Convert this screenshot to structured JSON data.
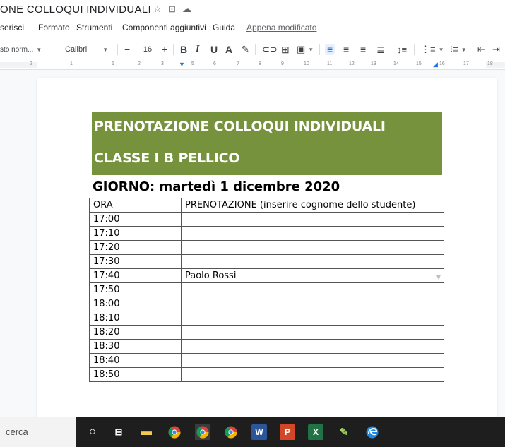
{
  "doc": {
    "title": "ONE COLLOQUI INDIVIDUALI"
  },
  "title_icons": [
    "star-icon",
    "move-to-folder-icon",
    "cloud-status-icon"
  ],
  "menu": {
    "items": [
      "serisci",
      "Formato",
      "Strumenti",
      "Componenti aggiuntivi",
      "Guida"
    ],
    "last_edit": "Appena modificato"
  },
  "toolbar": {
    "style_label": "sto norm...",
    "font_label": "Calibri",
    "font_size_minus": "−",
    "font_size": "16",
    "font_size_plus": "+",
    "bold": "B",
    "italic": "I",
    "underline": "U",
    "text_color": "A"
  },
  "ruler": {
    "ticks": [
      "2",
      "1",
      "1",
      "2",
      "3",
      "5",
      "6",
      "7",
      "8",
      "9",
      "10",
      "11",
      "12",
      "13",
      "14",
      "15",
      "16",
      "17",
      "18"
    ]
  },
  "document": {
    "banner_title": "PRENOTAZIONE COLLOQUI INDIVIDUALI",
    "banner_class": "CLASSE I B PELLICO",
    "banner_color": "#76923c",
    "day_line": "GIORNO: martedì 1 dicembre 2020",
    "table": {
      "headers": [
        "ORA",
        "PRENOTAZIONE (inserire cognome dello studente)"
      ],
      "rows": [
        [
          "17:00",
          ""
        ],
        [
          "17:10",
          ""
        ],
        [
          "17:20",
          ""
        ],
        [
          "17:30",
          ""
        ],
        [
          "17:40",
          "Paolo Rossi"
        ],
        [
          "17:50",
          ""
        ],
        [
          "18:00",
          ""
        ],
        [
          "18:10",
          ""
        ],
        [
          "18:20",
          ""
        ],
        [
          "18:30",
          ""
        ],
        [
          "18:40",
          ""
        ],
        [
          "18:50",
          ""
        ]
      ]
    }
  },
  "taskbar": {
    "search_text": "cerca",
    "icons": [
      "cortana-icon",
      "task-view-icon",
      "file-explorer-icon",
      "chrome-icon",
      "chrome-icon-2",
      "chrome-icon-3",
      "word-icon",
      "powerpoint-icon",
      "excel-icon",
      "paint-icon",
      "edge-icon"
    ]
  }
}
